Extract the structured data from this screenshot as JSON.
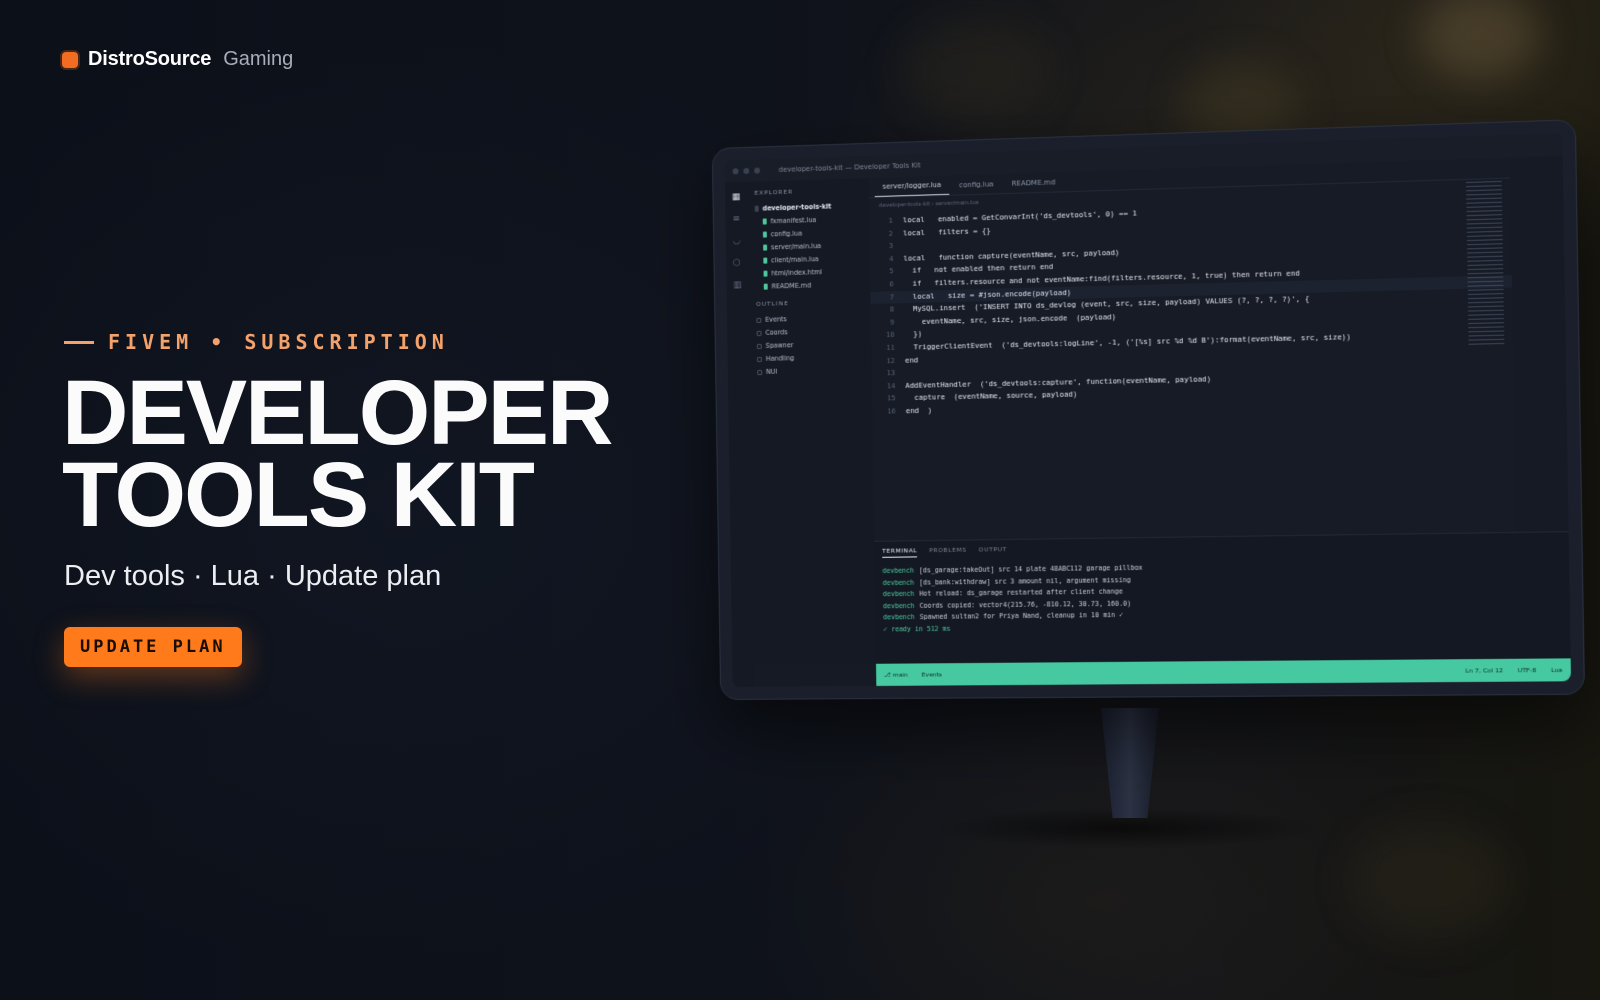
{
  "brand": {
    "name": "DistroSource",
    "sub": "Gaming"
  },
  "hero": {
    "eyebrow": "FIVEM • SUBSCRIPTION",
    "title_line1": "DEVELOPER",
    "title_line2": "TOOLS KIT",
    "subtitle": "Dev tools · Lua · Update plan",
    "cta_label": "UPDATE PLAN"
  },
  "colors": {
    "accent": "#ff7a1a",
    "eyebrow": "#f4a26b",
    "statusbar": "#46c9a0",
    "background": "#0d1119"
  },
  "ide": {
    "window_title": "developer-tools-kit — Developer Tools Kit",
    "activity_icons": [
      "files-icon",
      "list-icon",
      "mask-icon",
      "box-icon",
      "chart-icon"
    ],
    "explorer": {
      "header": "EXPLORER",
      "root": "developer-tools-kit",
      "files": [
        "fxmanifest.lua",
        "config.lua",
        "server/main.lua",
        "client/main.lua",
        "html/index.html",
        "README.md"
      ]
    },
    "outline": {
      "header": "OUTLINE",
      "items": [
        "Events",
        "Coords",
        "Spawner",
        "Handling",
        "NUI"
      ]
    },
    "tabs": [
      "server/logger.lua",
      "config.lua",
      "README.md"
    ],
    "breadcrumb": "developer-tools-kit › server/main.lua",
    "code_lines": [
      {
        "n": "1",
        "text": "local   enabled = GetConvarInt('ds_devtools', 0) == 1"
      },
      {
        "n": "2",
        "text": "local   filters = {}"
      },
      {
        "n": "3",
        "text": ""
      },
      {
        "n": "4",
        "text": "local   function capture(eventName, src, payload)"
      },
      {
        "n": "5",
        "text": "  if   not enabled then return end"
      },
      {
        "n": "6",
        "text": "  if   filters.resource and not eventName:find(filters.resource, 1, true) then return end"
      },
      {
        "n": "7",
        "text": "  local   size = #json.encode(payload)"
      },
      {
        "n": "8",
        "text": "  MySQL.insert  ('INSERT INTO ds_devlog (event, src, size, payload) VALUES (?, ?, ?, ?)', {"
      },
      {
        "n": "9",
        "text": "    eventName, src, size, json.encode  (payload)"
      },
      {
        "n": "10",
        "text": "  })"
      },
      {
        "n": "11",
        "text": "  TriggerClientEvent  ('ds_devtools:logLine', -1, ('[%s] src %d %d B'):format(eventName, src, size))"
      },
      {
        "n": "12",
        "text": "end"
      },
      {
        "n": "13",
        "text": ""
      },
      {
        "n": "14",
        "text": "AddEventHandler  ('ds_devtools:capture', function(eventName, payload)"
      },
      {
        "n": "15",
        "text": "  capture  (eventName, source, payload)"
      },
      {
        "n": "16",
        "text": "end  )"
      }
    ],
    "terminal": {
      "tabs": [
        "TERMINAL",
        "PROBLEMS",
        "OUTPUT"
      ],
      "lines": [
        {
          "prefix": "devbench",
          "msg": "[ds_garage:takeOut] src 14 plate 48ABC112 garage pillbox"
        },
        {
          "prefix": "devbench",
          "msg": "[ds_bank:withdraw] src 3 amount nil, argument missing"
        },
        {
          "prefix": "devbench",
          "msg": "Hot reload: ds_garage restarted after client change"
        },
        {
          "prefix": "devbench",
          "msg": "Coords copied: vector4(215.76, -810.12, 30.73, 160.0)"
        },
        {
          "prefix": "devbench",
          "msg": "Spawned sultan2 for Priya Nand, cleanup in 10 min ✓"
        }
      ],
      "ready": "✓ ready in 512 ms"
    },
    "statusbar": {
      "left": [
        "⎇ main",
        "Events"
      ],
      "right": [
        "Ln 7, Col 12",
        "UTF-8",
        "Lua"
      ]
    }
  }
}
